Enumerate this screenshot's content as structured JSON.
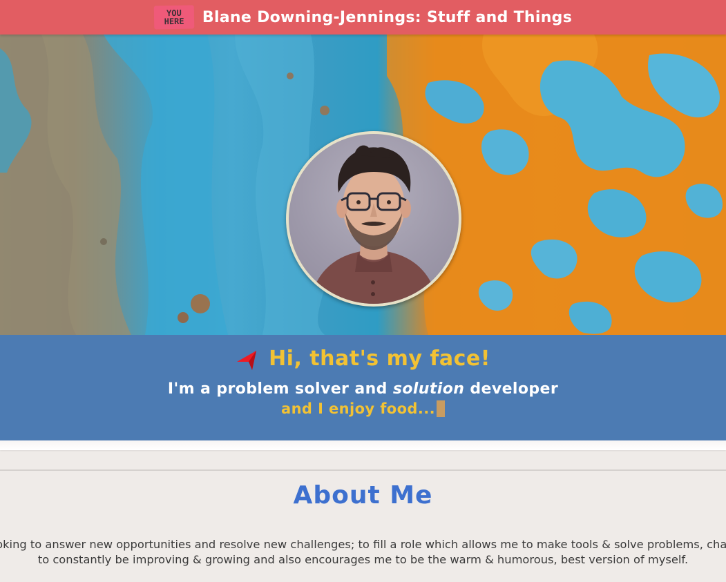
{
  "header": {
    "logo_line1": "YOU",
    "logo_line2": "HERE",
    "title": "Blane Downing-Jennings: Stuff and Things"
  },
  "hero": {
    "greeting": "Hi, that's my face!",
    "tagline_before": "I'm a problem solver and ",
    "tagline_emphasis": "solution",
    "tagline_after": " developer",
    "sub": "and I enjoy food..."
  },
  "about": {
    "title": "About Me",
    "line1": "oking to answer new opportunities and resolve new challenges; to fill a role which allows me to make tools & solve problems, chal",
    "line2": "to constantly be improving & growing and also encourages me to be the warm & humorous, best version of myself."
  },
  "colors": {
    "header_bg": "#e25d62",
    "band_bg": "#4c7bb3",
    "accent_yellow": "#f2c234",
    "about_blue": "#3d70cf",
    "page_bg": "#efebe8"
  },
  "icons": [
    "you-are-here-logo-icon",
    "red-cursor-arrow-icon"
  ]
}
